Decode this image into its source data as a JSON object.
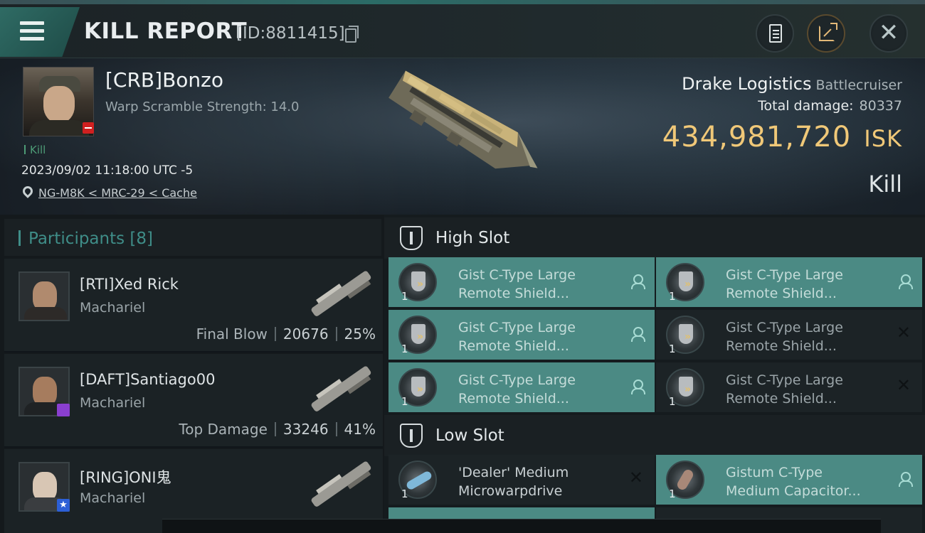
{
  "header": {
    "title": "KILL REPORT",
    "id_label": "[ID:8811415]"
  },
  "victim": {
    "name": "[CRB]Bonzo",
    "warp_scramble": "Warp Scramble Strength: 14.0",
    "kill_count": "Kill",
    "timestamp": "2023/09/02 11:18:00 UTC -5",
    "location": "NG-M8K < MRC-29 < Cache",
    "ship": "Drake Logistics",
    "ship_class": "Battlecruiser",
    "total_damage_label": "Total damage:",
    "total_damage": "80337",
    "isk_value": "434,981,720",
    "isk_unit": "ISK",
    "result": "Kill"
  },
  "participants": {
    "label": "Participants",
    "count": "[8]",
    "rows": [
      {
        "name": "[RTI]Xed Rick",
        "ship": "Machariel",
        "stat_label": "Final Blow",
        "damage": "20676",
        "pct": "25%"
      },
      {
        "name": "[DAFT]Santiago00",
        "ship": "Machariel",
        "stat_label": "Top Damage",
        "damage": "33246",
        "pct": "41%"
      },
      {
        "name": "[RING]ONI鬼",
        "ship": "Machariel",
        "stat_label": "",
        "damage": "",
        "pct": ""
      }
    ]
  },
  "fitting": {
    "high_slot_label": "High Slot",
    "low_slot_label": "Low Slot",
    "high_slots": [
      {
        "line1": "Gist C-Type Large",
        "line2": "Remote Shield...",
        "qty": "1",
        "state": "fitted",
        "indicator": "pilot"
      },
      {
        "line1": "Gist C-Type Large",
        "line2": "Remote Shield...",
        "qty": "1",
        "state": "fitted",
        "indicator": "pilot"
      },
      {
        "line1": "Gist C-Type Large",
        "line2": "Remote Shield...",
        "qty": "1",
        "state": "fitted",
        "indicator": "pilot"
      },
      {
        "line1": "Gist C-Type Large",
        "line2": "Remote Shield...",
        "qty": "1",
        "state": "destroyed",
        "indicator": "x"
      },
      {
        "line1": "Gist C-Type Large",
        "line2": "Remote Shield...",
        "qty": "1",
        "state": "fitted",
        "indicator": "pilot"
      },
      {
        "line1": "Gist C-Type Large",
        "line2": "Remote Shield...",
        "qty": "1",
        "state": "destroyed",
        "indicator": "x"
      }
    ],
    "low_slots": [
      {
        "line1": "'Dealer' Medium",
        "line2": "Microwarpdrive",
        "qty": "1",
        "state": "destroyed",
        "indicator": "x"
      },
      {
        "line1": "Gistum C-Type",
        "line2": "Medium Capacitor...",
        "qty": "1",
        "state": "fitted",
        "indicator": "pilot"
      }
    ]
  },
  "colors": {
    "accent_teal": "#3f8d88",
    "isk_gold": "#f0c878",
    "fitted_bg": "#4b8a84",
    "badge_red": "#d02020",
    "badge_purple": "#8a3fd0",
    "badge_blue": "#2c5fd6"
  }
}
